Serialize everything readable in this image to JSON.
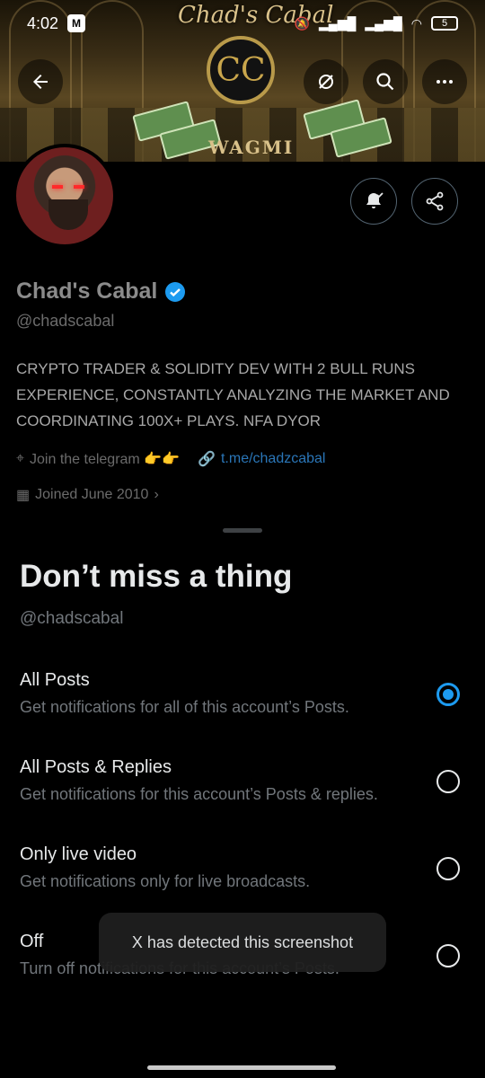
{
  "status_bar": {
    "time": "4:02",
    "battery": "5"
  },
  "banner": {
    "title": "Chad's Cabal",
    "badge": "WAGMI",
    "logo_text": "CC"
  },
  "nav": {
    "back_icon": "arrow-left-icon",
    "icons": [
      "sync-off-icon",
      "search-icon",
      "more-icon"
    ]
  },
  "profile": {
    "name": "Chad's Cabal",
    "handle": "@chadscabal",
    "bio": "CRYPTO TRADER & SOLIDITY DEV WITH 2 BULL RUNS EXPERIENCE, CONSTANTLY ANALYZING THE MARKET AND COORDINATING 100X+ PLAYS. NFA DYOR",
    "location": "Join the telegram 👉👉",
    "link": "t.me/chadzcabal",
    "joined": "Joined June 2010",
    "verified_color": "#1d9bf0"
  },
  "sheet": {
    "title": "Don’t miss a thing",
    "handle": "@chadscabal",
    "options": [
      {
        "title": "All Posts",
        "desc": "Get notifications for all of this account’s Posts.",
        "selected": true
      },
      {
        "title": "All Posts & Replies",
        "desc": "Get notifications for this account’s Posts & replies.",
        "selected": false
      },
      {
        "title": "Only live video",
        "desc": "Get notifications only for live broadcasts.",
        "selected": false
      },
      {
        "title": "Off",
        "desc": "Turn off notifications for this account’s Posts.",
        "selected": false
      }
    ]
  },
  "toast": {
    "text": "X has detected this screenshot"
  },
  "colors": {
    "accent": "#1d9bf0",
    "background": "#000000"
  }
}
